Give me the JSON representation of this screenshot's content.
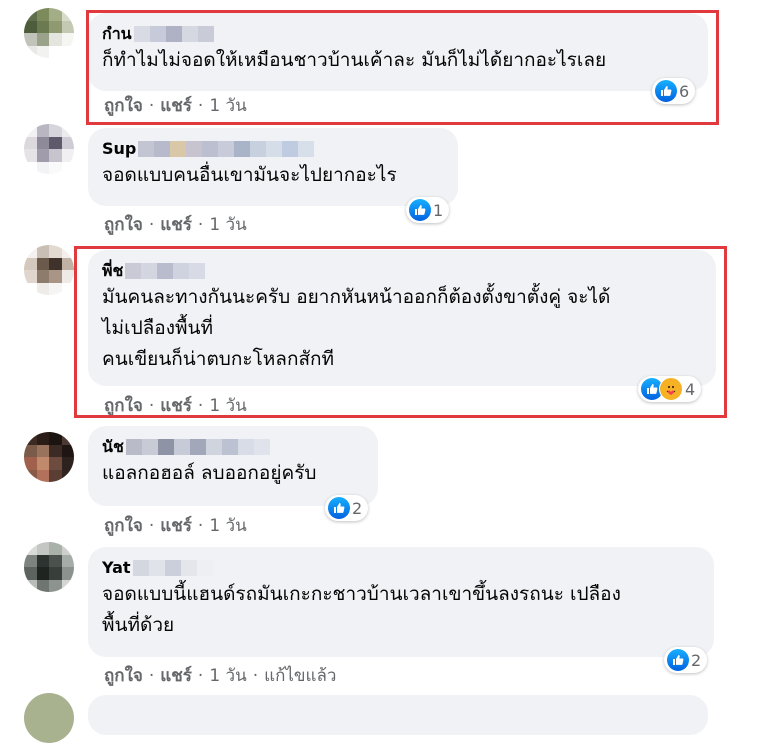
{
  "colors": {
    "highlight": "#e0393e",
    "bubble": "#f0f2f5",
    "meta": "#65676b",
    "like": "#1877f2"
  },
  "comments": [
    {
      "author": "กำน",
      "text": "ก็ทำไมไม่จอดให้เหมือนชาวบ้านเค้าละ มันก็ไม่ได้ยากอะไรเลย",
      "reactions": [
        "like"
      ],
      "count": "6",
      "like": "ถูกใจ",
      "share": "แชร์",
      "time": "1 วัน",
      "edited": ""
    },
    {
      "author": "Sup",
      "text": "จอดแบบคนอื่นเขามันจะไปยากอะไร",
      "reactions": [
        "like"
      ],
      "count": "1",
      "like": "ถูกใจ",
      "share": "แชร์",
      "time": "1 วัน",
      "edited": ""
    },
    {
      "author": "พี่ช",
      "text": "มันคนละทางกันนะครับ อยากหันหน้าออกก็ต้องตั้งขาตั้งคู่ จะได้\nไม่เปลืองพื้นที่\nคนเขียนก็น่าตบกะโหลกสักที",
      "reactions": [
        "like",
        "care"
      ],
      "count": "4",
      "like": "ถูกใจ",
      "share": "แชร์",
      "time": "1 วัน",
      "edited": ""
    },
    {
      "author": "นัช",
      "text": "แอลกอฮอล์ ลบออกอยู่ครับ",
      "reactions": [
        "like"
      ],
      "count": "2",
      "like": "ถูกใจ",
      "share": "แชร์",
      "time": "1 วัน",
      "edited": ""
    },
    {
      "author": "Yat",
      "text": "จอดแบบนี้แฮนด์รถมันเกะกะชาวบ้านเวลาเขาขึ้นลงรถนะ เปลือง\nพื้นที่ด้วย",
      "reactions": [
        "like"
      ],
      "count": "2",
      "like": "ถูกใจ",
      "share": "แชร์",
      "time": "1 วัน",
      "edited": "แก้ไขแล้ว"
    }
  ]
}
